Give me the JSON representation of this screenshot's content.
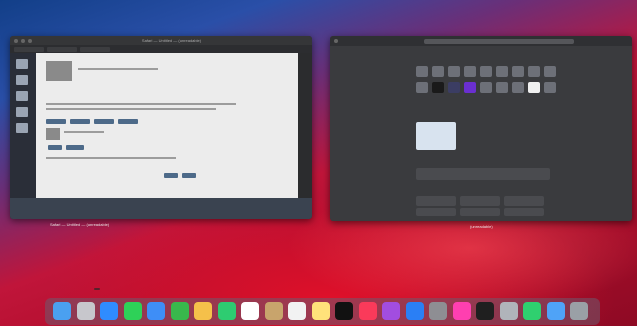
{
  "browser_window": {
    "caption": "Safari — Untitled — (unreadable)",
    "footer_links": [
      "",
      "",
      "",
      "",
      ""
    ]
  },
  "settings_window": {
    "caption": "(unreadable)",
    "sections": [
      "",
      "",
      "",
      ""
    ]
  },
  "dock": {
    "tooltip": "",
    "apps": [
      {
        "name": "finder",
        "color": "#4aa0f0"
      },
      {
        "name": "launchpad",
        "color": "#c7c7cc"
      },
      {
        "name": "safari",
        "color": "#2f8cff"
      },
      {
        "name": "messages",
        "color": "#2ed158"
      },
      {
        "name": "mail",
        "color": "#3e8ef7"
      },
      {
        "name": "maps",
        "color": "#39b84c"
      },
      {
        "name": "photos",
        "color": "#f5c04a"
      },
      {
        "name": "facetime",
        "color": "#2ecc71"
      },
      {
        "name": "calendar",
        "color": "#ffffff"
      },
      {
        "name": "contacts",
        "color": "#c8a46c"
      },
      {
        "name": "reminders",
        "color": "#f2f2f2"
      },
      {
        "name": "notes",
        "color": "#ffe27a"
      },
      {
        "name": "tv",
        "color": "#111111"
      },
      {
        "name": "music",
        "color": "#fa3a5a"
      },
      {
        "name": "podcasts",
        "color": "#a24de0"
      },
      {
        "name": "app-store",
        "color": "#2a7ff5"
      },
      {
        "name": "system-preferences",
        "color": "#8e8e93"
      },
      {
        "name": "arc",
        "color": "#ff3fb0"
      },
      {
        "name": "terminal",
        "color": "#1f1f1f"
      },
      {
        "name": "disk-utility",
        "color": "#b0b4ba"
      },
      {
        "name": "green-app",
        "color": "#2fd06f"
      },
      {
        "name": "folder",
        "color": "#4fa3f7"
      },
      {
        "name": "trash",
        "color": "#9aa0a6"
      }
    ]
  }
}
